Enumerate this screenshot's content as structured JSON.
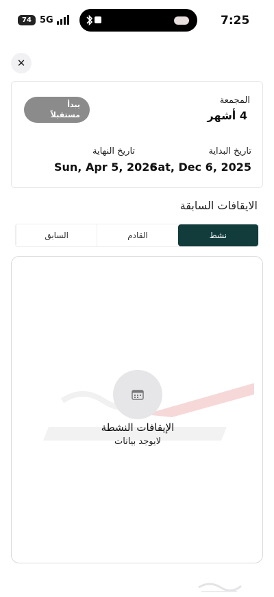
{
  "status_bar": {
    "battery": "74",
    "network": "5G",
    "time": "7:25"
  },
  "icons": {
    "close": "close-icon",
    "calendar": "calendar-icon",
    "bluetooth": "bluetooth-icon",
    "signal": "signal-icon"
  },
  "summary": {
    "total_label": "المجمعة",
    "total_value": "4 أشهر",
    "status_badge_line1": "يبدأ",
    "status_badge_line2": "مستقبلاً",
    "start_label": "تاريخ البداية",
    "start_value": "Sat, Dec 6, 2025",
    "end_label": "تاريخ النهاية",
    "end_value": "Sun, Apr 5, 2026"
  },
  "section_title": "الايقافات السابقة",
  "tabs": [
    {
      "label": "نشط",
      "active": true
    },
    {
      "label": "القادم",
      "active": false
    },
    {
      "label": "السابق",
      "active": false
    }
  ],
  "empty_state": {
    "title": "الإيقافات النشطة",
    "subtitle": "لايوجد بيانات"
  },
  "colors": {
    "accent": "#123b3b",
    "badge": "#8b8b8b"
  }
}
